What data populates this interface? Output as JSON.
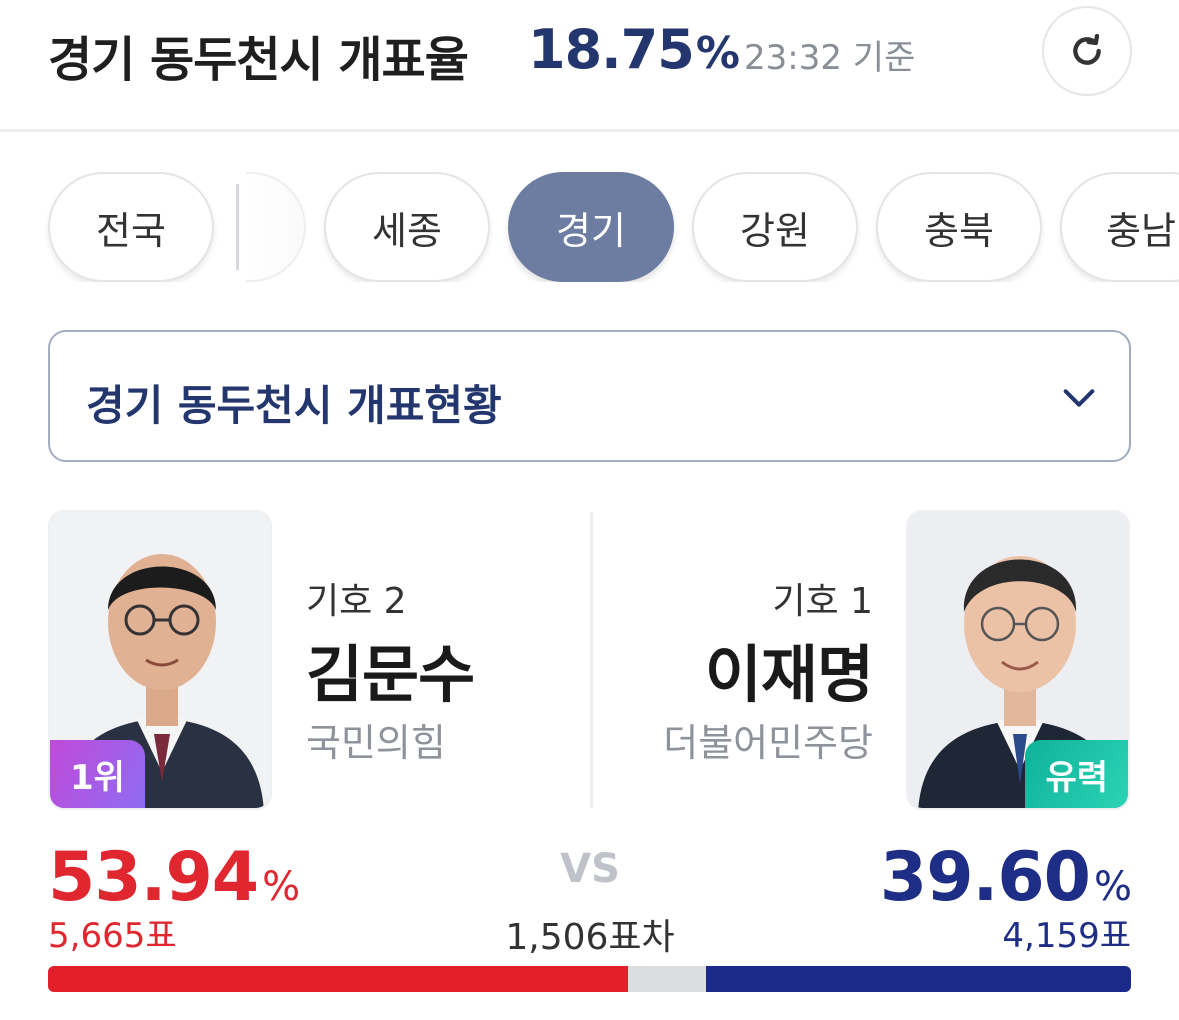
{
  "header": {
    "title": "경기 동두천시 개표율",
    "rate": "18.75",
    "rate_unit": "%",
    "time": "23:32 기준",
    "refresh_icon": "refresh-icon"
  },
  "tabs": [
    {
      "label": "전국",
      "active": false
    },
    {
      "label": "세종",
      "active": false
    },
    {
      "label": "경기",
      "active": true
    },
    {
      "label": "강원",
      "active": false
    },
    {
      "label": "충북",
      "active": false
    },
    {
      "label": "충남",
      "active": false
    }
  ],
  "dropdown": {
    "label": "경기 동두천시 개표현황",
    "icon": "chevron-down-icon"
  },
  "candidates": {
    "left": {
      "number": "기호 2",
      "name": "김문수",
      "party": "국민의힘",
      "badge": "1위",
      "percent": "53.94",
      "percent_unit": "%",
      "votes": "5,665표",
      "share": 53.94
    },
    "right": {
      "number": "기호 1",
      "name": "이재명",
      "party": "더불어민주당",
      "badge": "유력",
      "percent": "39.60",
      "percent_unit": "%",
      "votes": "4,159표",
      "share": 39.6
    }
  },
  "comparison": {
    "vs": "VS",
    "difference": "1,506표차"
  },
  "colors": {
    "left": "#e31f2b",
    "right": "#1b2a8a",
    "accent": "#24366e",
    "active_tab": "#6c7da1"
  }
}
